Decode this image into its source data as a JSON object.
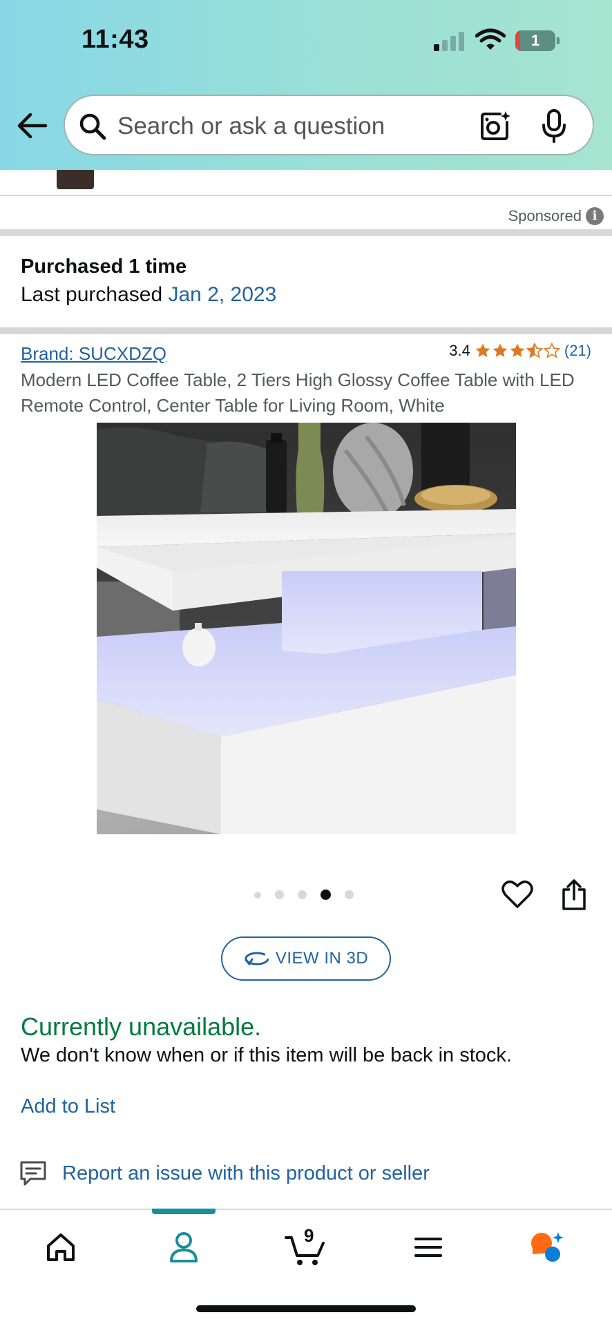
{
  "status_bar": {
    "time": "11:43",
    "battery_level": "1"
  },
  "search": {
    "placeholder": "Search or ask a question"
  },
  "icons": {
    "back": "arrow-left-icon",
    "search": "search-icon",
    "lens": "camera-lens-icon",
    "mic": "microphone-icon",
    "info": "info-icon",
    "heart": "heart-icon",
    "share": "share-icon",
    "rotate_3d": "rotate-3d-icon",
    "report": "report-chat-icon",
    "home": "home-icon",
    "account": "account-icon",
    "cart": "cart-icon",
    "menu": "menu-icon",
    "rufus": "rufus-assistant-icon"
  },
  "sponsored": {
    "label": "Sponsored",
    "info_glyph": "i"
  },
  "purchase_history": {
    "title": "Purchased 1 time",
    "last_label": "Last purchased ",
    "last_date": "Jan 2, 2023"
  },
  "product": {
    "brand_link": "Brand: SUCXDZQ",
    "rating_value": "3.4",
    "rating_stars": 3.5,
    "review_count": "(21)",
    "title": "Modern LED Coffee Table, 2 Tiers High Glossy Coffee Table with LED Remote Control, Center Table for Living Room, White",
    "image_count": 5,
    "active_image": 4
  },
  "actions": {
    "view_3d": "VIEW IN 3D",
    "add_to_list": "Add to List",
    "report": "Report an issue with this product or seller"
  },
  "availability": {
    "status": "Currently unavailable.",
    "note": "We don't know when or if this item will be back in stock."
  },
  "nav": {
    "cart_count": "9",
    "active": "account"
  },
  "colors": {
    "link": "#2162a1",
    "available_green": "#007a3d",
    "star": "#de7921",
    "nav_active": "#1a8e98",
    "rufus_orange": "#ff6a13",
    "rufus_blue": "#0a7ed8"
  }
}
